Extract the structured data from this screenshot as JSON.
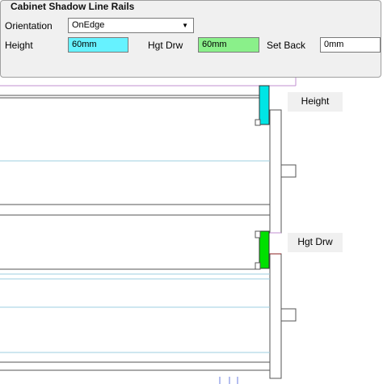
{
  "panel": {
    "title": "Cabinet Shadow Line Rails",
    "orientation_label": "Orientation",
    "orientation_value": "OnEdge",
    "height_label": "Height",
    "height_value": "60mm",
    "hgt_drw_label": "Hgt Drw",
    "hgt_drw_value": "60mm",
    "set_back_label": "Set Back",
    "set_back_value": "0mm"
  },
  "diagram": {
    "callout_height": "Height",
    "callout_hgt_drw": "Hgt Drw"
  },
  "colors": {
    "height_field": "#66f2ff",
    "hgt_drw_field": "#8af08a",
    "rail_top": "#00e5e5",
    "rail_bottom": "#00e000",
    "guide_line": "#9ccfe0"
  }
}
